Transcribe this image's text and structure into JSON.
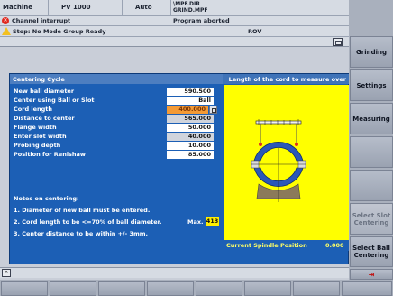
{
  "header": {
    "row1": {
      "mode": "Machine",
      "channel": "PV  1000",
      "auto": "Auto",
      "program_dir": "\\MPF.DIR",
      "program_file": "GRIND.MPF"
    },
    "row2": {
      "alarm": "Channel interrupt",
      "program_status": "Program aborted"
    },
    "row3": {
      "stop_text": "Stop: No Mode Group Ready",
      "rov": "ROV"
    }
  },
  "panel": {
    "title": "Centering Cycle",
    "hint": "Length of the cord to measure over",
    "fields": [
      {
        "label": "New ball diameter",
        "value": "590.500",
        "style": "white"
      },
      {
        "label": "Center using Ball or Slot",
        "value": "Ball",
        "style": "white"
      },
      {
        "label": "Cord length",
        "value": "400.000",
        "style": "orange"
      },
      {
        "label": "Distance to center",
        "value": "565.000",
        "style": "gray"
      },
      {
        "label": "Flange width",
        "value": "50.000",
        "style": "white"
      },
      {
        "label": "Enter slot width",
        "value": "40.000",
        "style": "gray"
      },
      {
        "label": "Probing depth",
        "value": "10.000",
        "style": "white"
      },
      {
        "label": "Position for Renishaw",
        "value": "85.000",
        "style": "white"
      }
    ],
    "notes_title": "Notes on centering:",
    "notes": [
      "1. Diameter of new ball must be entered.",
      "2. Cord length to be <=70% of ball diameter.",
      "3. Center distance to be within +/- 3mm."
    ],
    "max_label": "Max.",
    "max_value": "413",
    "spindle_label": "Current Spindle Position",
    "spindle_value": "0.000"
  },
  "softkeys_right": [
    {
      "label": "Grinding",
      "enabled": true
    },
    {
      "label": "Settings",
      "enabled": true
    },
    {
      "label": "Measuring",
      "enabled": true
    },
    {
      "label": "",
      "enabled": true
    },
    {
      "label": "",
      "enabled": true
    },
    {
      "label": "Select Slot Centering",
      "enabled": false
    },
    {
      "label": "Select Ball Centering",
      "enabled": true
    },
    {
      "label": "",
      "enabled": true
    }
  ],
  "colors": {
    "panel_bg": "#1c5fb5",
    "diagram_bg": "#ffff00",
    "accent_orange": "#f39a36"
  }
}
